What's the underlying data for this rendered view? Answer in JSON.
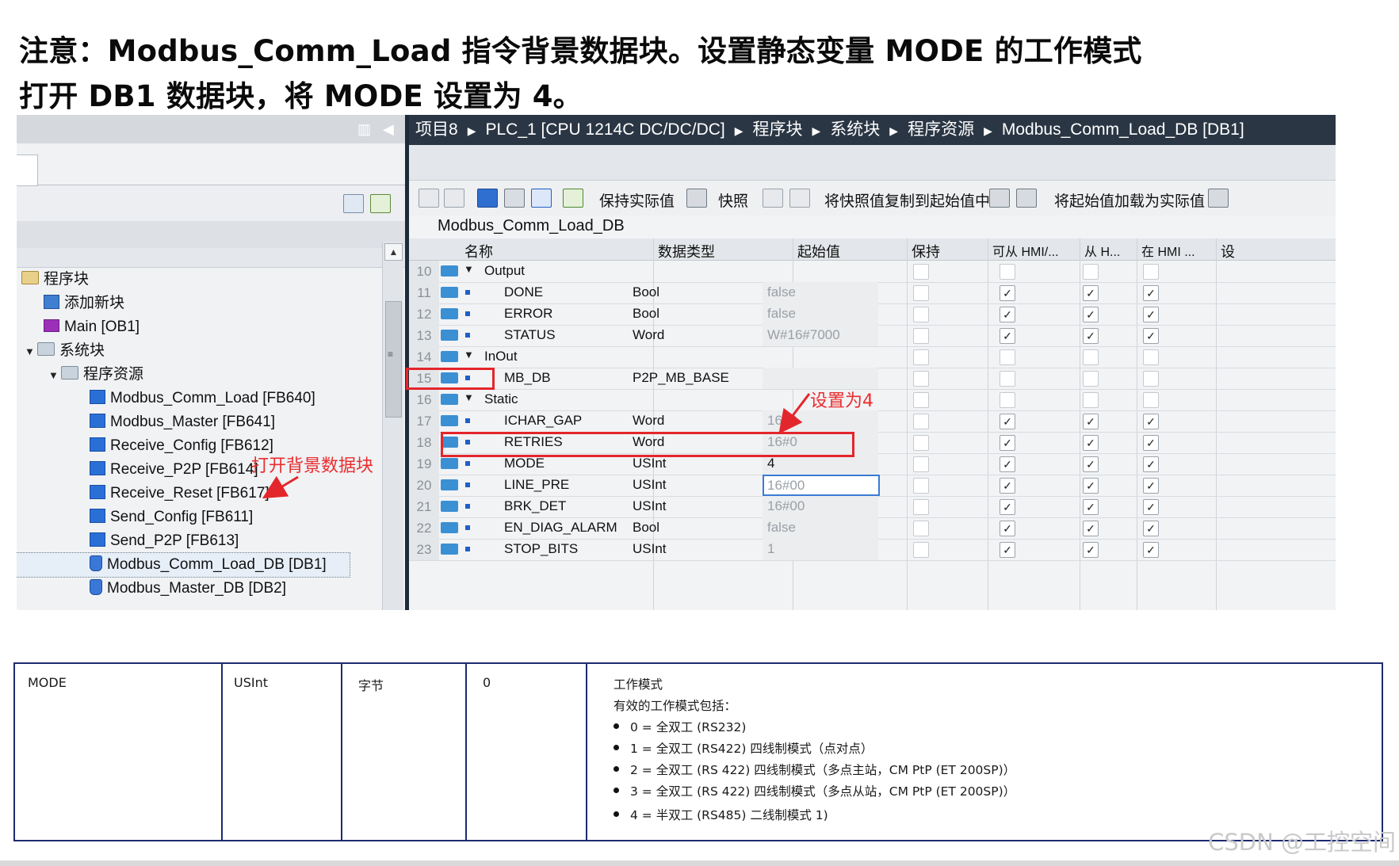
{
  "heading": {
    "line1": "注意：Modbus_Comm_Load  指令背景数据块。设置静态变量 MODE 的工作模式",
    "line2": "打开 DB1 数据块，将 MODE 设置为 4。"
  },
  "breadcrumb": [
    "项目8",
    "PLC_1 [CPU 1214C DC/DC/DC]",
    "程序块",
    "系统块",
    "程序资源",
    "Modbus_Comm_Load_DB [DB1]"
  ],
  "toolbar": {
    "keep_actual": "保持实际值",
    "snapshot": "快照",
    "copy_snapshot": "将快照值复制到起始值中",
    "load_start": "将起始值加载为实际值"
  },
  "db_title": "Modbus_Comm_Load_DB",
  "columns": {
    "name": "名称",
    "datatype": "数据类型",
    "start": "起始值",
    "retain": "保持",
    "hmi_access": "可从 HMI/...",
    "hmi_write": "从 H...",
    "hmi_visible": "在 HMI ...",
    "setpoint": "设"
  },
  "tree": [
    {
      "label": "程序块",
      "icon": "folder-icon"
    },
    {
      "label": "添加新块",
      "icon": "add-block-icon"
    },
    {
      "label": "Main [OB1]",
      "icon": "ob-icon"
    },
    {
      "label": "系统块",
      "icon": "system-folder-icon"
    },
    {
      "label": "程序资源",
      "icon": "system-folder-icon"
    },
    {
      "label": "Modbus_Comm_Load [FB640]",
      "icon": "function-block-icon"
    },
    {
      "label": "Modbus_Master [FB641]",
      "icon": "function-block-icon"
    },
    {
      "label": "Receive_Config [FB612]",
      "icon": "function-block-icon"
    },
    {
      "label": "Receive_P2P [FB614]",
      "icon": "function-block-icon"
    },
    {
      "label": "Receive_Reset [FB617]",
      "icon": "function-block-icon"
    },
    {
      "label": "Send_Config [FB611]",
      "icon": "function-block-icon"
    },
    {
      "label": "Send_P2P [FB613]",
      "icon": "function-block-icon"
    },
    {
      "label": "Modbus_Comm_Load_DB [DB1]",
      "icon": "data-block-icon"
    },
    {
      "label": "Modbus_Master_DB [DB2]",
      "icon": "data-block-icon"
    }
  ],
  "rows": [
    {
      "num": "10",
      "name": "Output",
      "type": "",
      "start": "",
      "group": true
    },
    {
      "num": "11",
      "name": "DONE",
      "type": "Bool",
      "start": "false"
    },
    {
      "num": "12",
      "name": "ERROR",
      "type": "Bool",
      "start": "false"
    },
    {
      "num": "13",
      "name": "STATUS",
      "type": "Word",
      "start": "W#16#7000"
    },
    {
      "num": "14",
      "name": "InOut",
      "type": "",
      "start": "",
      "group": true
    },
    {
      "num": "15",
      "name": "MB_DB",
      "type": "P2P_MB_BASE",
      "start": ""
    },
    {
      "num": "16",
      "name": "Static",
      "type": "",
      "start": "",
      "group": true
    },
    {
      "num": "17",
      "name": "ICHAR_GAP",
      "type": "Word",
      "start": "16#0"
    },
    {
      "num": "18",
      "name": "RETRIES",
      "type": "Word",
      "start": "16#0"
    },
    {
      "num": "19",
      "name": "MODE",
      "type": "USInt",
      "start": "4"
    },
    {
      "num": "20",
      "name": "LINE_PRE",
      "type": "USInt",
      "start": "16#00"
    },
    {
      "num": "21",
      "name": "BRK_DET",
      "type": "USInt",
      "start": "16#00"
    },
    {
      "num": "22",
      "name": "EN_DIAG_ALARM",
      "type": "Bool",
      "start": "false"
    },
    {
      "num": "23",
      "name": "STOP_BITS",
      "type": "USInt",
      "start": "1"
    }
  ],
  "annotations": {
    "set_to_4": "设置为4",
    "open_db": "打开背景数据块"
  },
  "param_table": {
    "name": "MODE",
    "type": "USInt",
    "unit": "字节",
    "default": "0",
    "desc_title": "工作模式",
    "desc_intro": "有效的工作模式包括：",
    "modes": [
      "0 = 全双工 (RS232)",
      "1 = 全双工 (RS422) 四线制模式（点对点）",
      "2 = 全双工 (RS 422) 四线制模式（多点主站，CM PtP (ET 200SP)）",
      "3 = 全双工 (RS 422) 四线制模式（多点从站，CM PtP (ET 200SP)）",
      "4 = 半双工 (RS485) 二线制模式 1)"
    ]
  },
  "watermark": "CSDN @工控空间"
}
